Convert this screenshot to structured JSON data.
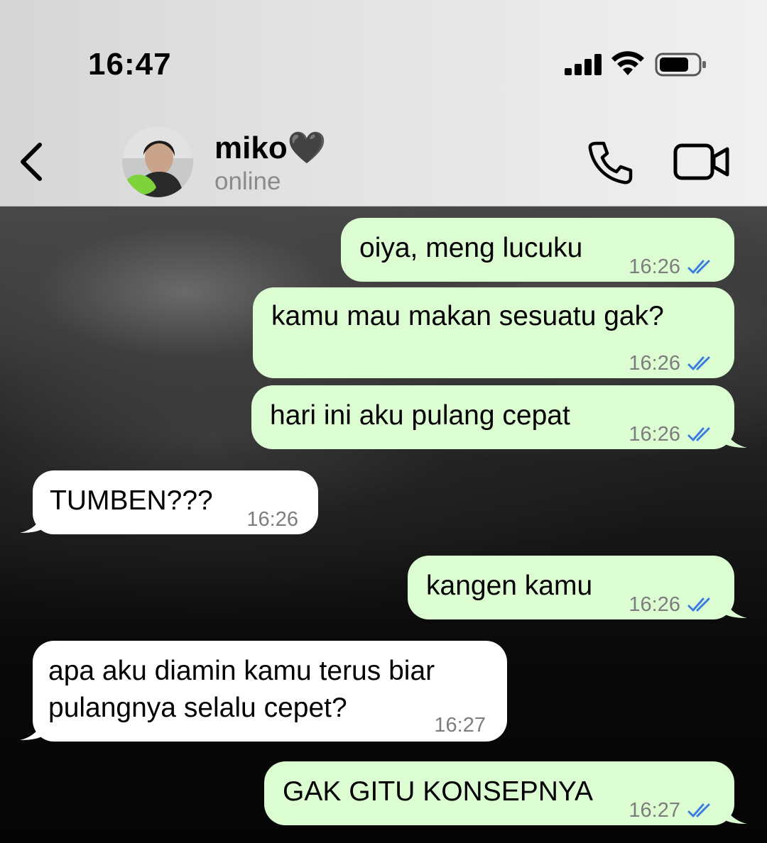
{
  "status_bar": {
    "time": "16:47"
  },
  "header": {
    "contact_name": "miko🖤",
    "contact_status": "online",
    "icons": [
      "back-icon",
      "avatar",
      "phone-icon",
      "video-icon"
    ]
  },
  "colors": {
    "outgoing_bubble": "#dcfdd2",
    "incoming_bubble": "#ffffff",
    "read_tick": "#3a7fe0"
  },
  "messages": [
    {
      "direction": "out",
      "text": "oiya, meng lucuku",
      "time": "16:26",
      "read": true
    },
    {
      "direction": "out",
      "text": "kamu mau makan sesuatu gak?",
      "time": "16:26",
      "read": true
    },
    {
      "direction": "out",
      "text": "hari ini aku pulang cepat",
      "time": "16:26",
      "read": true
    },
    {
      "direction": "in",
      "text": "TUMBEN???",
      "time": "16:26"
    },
    {
      "direction": "out",
      "text": "kangen kamu",
      "time": "16:26",
      "read": true
    },
    {
      "direction": "in",
      "text": "apa aku diamin kamu terus biar",
      "text2": "pulangnya selalu cepet?",
      "time": "16:27"
    },
    {
      "direction": "out",
      "text": "GAK GITU KONSEPNYA",
      "time": "16:27",
      "read": true
    }
  ]
}
